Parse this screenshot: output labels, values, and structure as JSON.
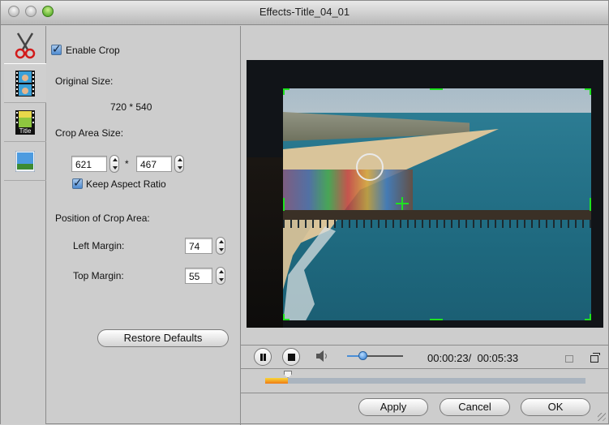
{
  "window": {
    "title": "Effects-Title_04_01",
    "traffic_lights": [
      "close",
      "minimize",
      "zoom"
    ]
  },
  "sidebar": {
    "tabs": [
      {
        "name": "crop",
        "icon": "scissors-icon",
        "active": false
      },
      {
        "name": "effect",
        "icon": "film-effect-icon",
        "active": true
      },
      {
        "name": "watermark-title",
        "icon": "film-title-icon",
        "label": "Title",
        "active": false
      },
      {
        "name": "picture",
        "icon": "picture-icon",
        "active": false
      }
    ]
  },
  "crop_panel": {
    "enable_crop_label": "Enable Crop",
    "enable_crop_checked": true,
    "original_size_label": "Original Size:",
    "original_size_value": "720 * 540",
    "crop_area_size_label": "Crop Area Size:",
    "crop_width": "621",
    "crop_times": "*",
    "crop_height": "467",
    "keep_aspect_label": "Keep Aspect Ratio",
    "keep_aspect_checked": true,
    "position_label": "Position of Crop Area:",
    "left_margin_label": "Left Margin:",
    "left_margin_value": "74",
    "top_margin_label": "Top Margin:",
    "top_margin_value": "55",
    "restore_defaults_label": "Restore Defaults"
  },
  "player": {
    "pause_icon": "pause-icon",
    "stop_icon": "stop-icon",
    "volume_icon": "speaker-icon",
    "volume_level_percent": 28,
    "current_time": "00:00:23",
    "separator": "/",
    "total_time": "00:05:33",
    "progress_fraction": 0.07,
    "fit_icon": "window-icon",
    "fullscreen_icon": "popout-window-icon"
  },
  "buttons": {
    "apply": "Apply",
    "cancel": "Cancel",
    "ok": "OK"
  },
  "colors": {
    "crop_handle": "#1fe21f",
    "progress_fill": "#ef7a13",
    "volume_accent": "#2a78cd"
  }
}
